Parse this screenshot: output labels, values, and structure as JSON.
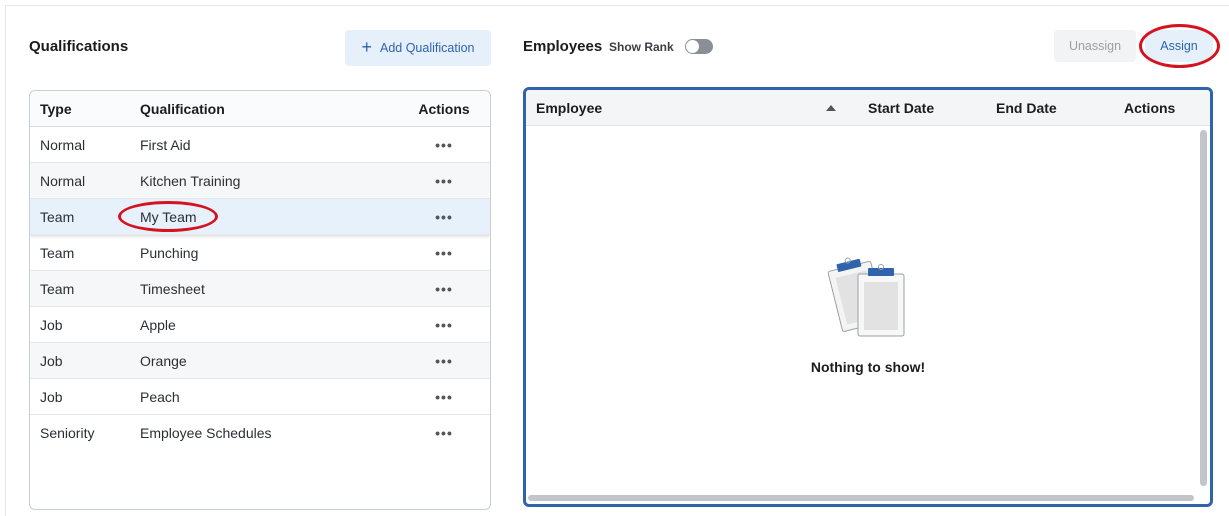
{
  "qualifications": {
    "title": "Qualifications",
    "add_button": "Add Qualification",
    "columns": {
      "type": "Type",
      "qualification": "Qualification",
      "actions": "Actions"
    },
    "rows": [
      {
        "type": "Normal",
        "qualification": "First Aid"
      },
      {
        "type": "Normal",
        "qualification": "Kitchen Training"
      },
      {
        "type": "Team",
        "qualification": "My Team"
      },
      {
        "type": "Team",
        "qualification": "Punching"
      },
      {
        "type": "Team",
        "qualification": "Timesheet"
      },
      {
        "type": "Job",
        "qualification": "Apple"
      },
      {
        "type": "Job",
        "qualification": "Orange"
      },
      {
        "type": "Job",
        "qualification": "Peach"
      },
      {
        "type": "Seniority",
        "qualification": "Employee Schedules"
      }
    ],
    "selected_row_index": 2,
    "row_action_icon": "more-horizontal-icon"
  },
  "employees": {
    "title": "Employees",
    "show_rank_label": "Show Rank",
    "show_rank_enabled": false,
    "unassign_button": "Unassign",
    "assign_button": "Assign",
    "columns": {
      "employee": "Employee",
      "start_date": "Start Date",
      "end_date": "End Date",
      "actions": "Actions"
    },
    "sort": "ascending",
    "empty_message": "Nothing to show!",
    "empty_icon": "clipboard-icon"
  },
  "colors": {
    "accent": "#2f64ad",
    "accent_bg": "#e5f0fb",
    "selected_row": "#e6f1fb",
    "annotation": "#d4131e"
  }
}
